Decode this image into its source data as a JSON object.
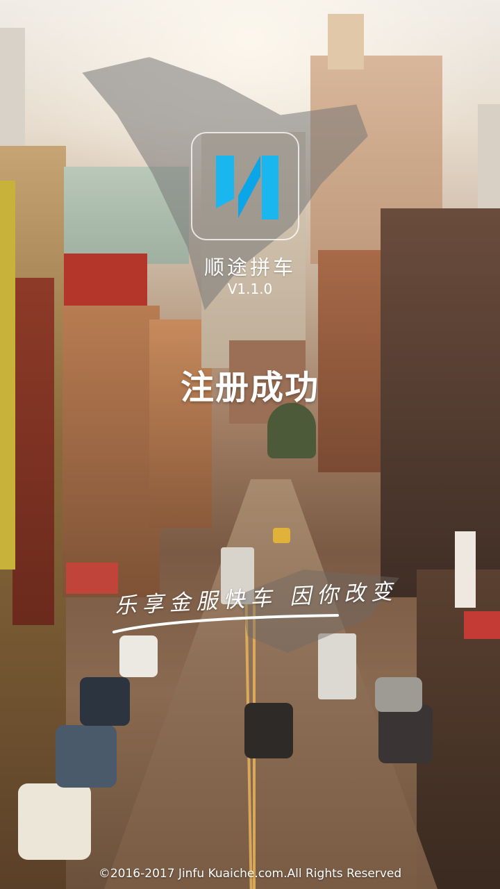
{
  "app": {
    "name": "顺途拼车",
    "version": "V1.1.0",
    "logo_colors": [
      "#1ab6f0",
      "#0aa6e8"
    ]
  },
  "status": {
    "message": "注册成功"
  },
  "slogan": "乐享金服快车 因你改变",
  "footer": {
    "copyright": "©2016-2017 Jinfu Kuaiche.com.All Rights Reserved"
  },
  "background": {
    "icon": "city-street-photo"
  }
}
